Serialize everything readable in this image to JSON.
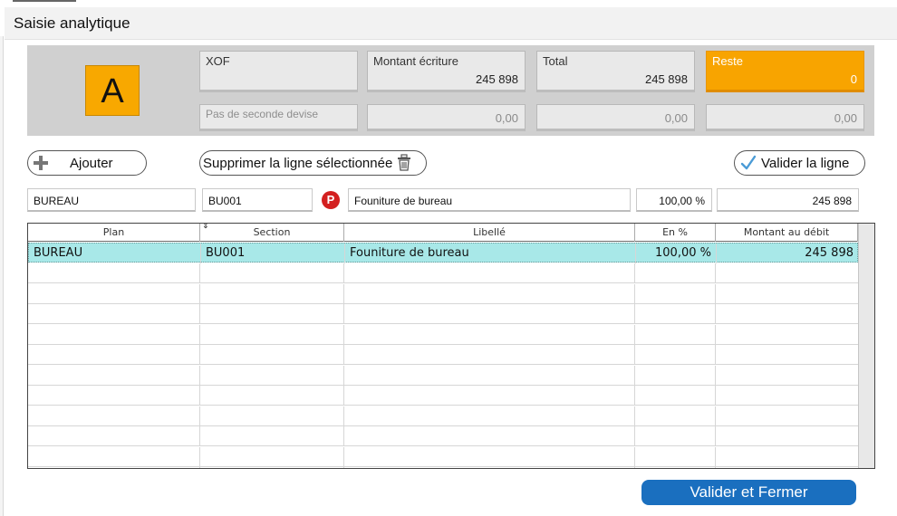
{
  "window": {
    "title": "Saisie analytique"
  },
  "summary": {
    "letter": "A",
    "currency": "XOF",
    "second_currency": "Pas de seconde devise",
    "montant_ecriture_label": "Montant écriture",
    "montant_ecriture_value": "245 898",
    "montant_ecriture_second": "0,00",
    "total_label": "Total",
    "total_value": "245 898",
    "total_second": "0,00",
    "reste_label": "Reste",
    "reste_value": "0",
    "reste_second": "0,00"
  },
  "toolbar": {
    "add_label": "Ajouter",
    "delete_label": "Supprimer la ligne sélectionnée",
    "validate_line_label": "Valider la ligne"
  },
  "edit_row": {
    "plan": "BUREAU",
    "section": "BU001",
    "libelle": "Founiture de bureau",
    "percent": "100,00 %",
    "montant": "245 898"
  },
  "table": {
    "headers": [
      "Plan",
      "Section",
      "Libellé",
      "En %",
      "Montant au débit"
    ],
    "rows": [
      [
        "BUREAU",
        "BU001",
        "Founiture de bureau",
        "100,00 %",
        "245 898"
      ]
    ]
  },
  "footer": {
    "validate_close_label": "Valider et Fermer"
  },
  "colors": {
    "accent_orange": "#f8a400",
    "primary_blue": "#1a6fbf",
    "selection": "#a8e8e8"
  }
}
